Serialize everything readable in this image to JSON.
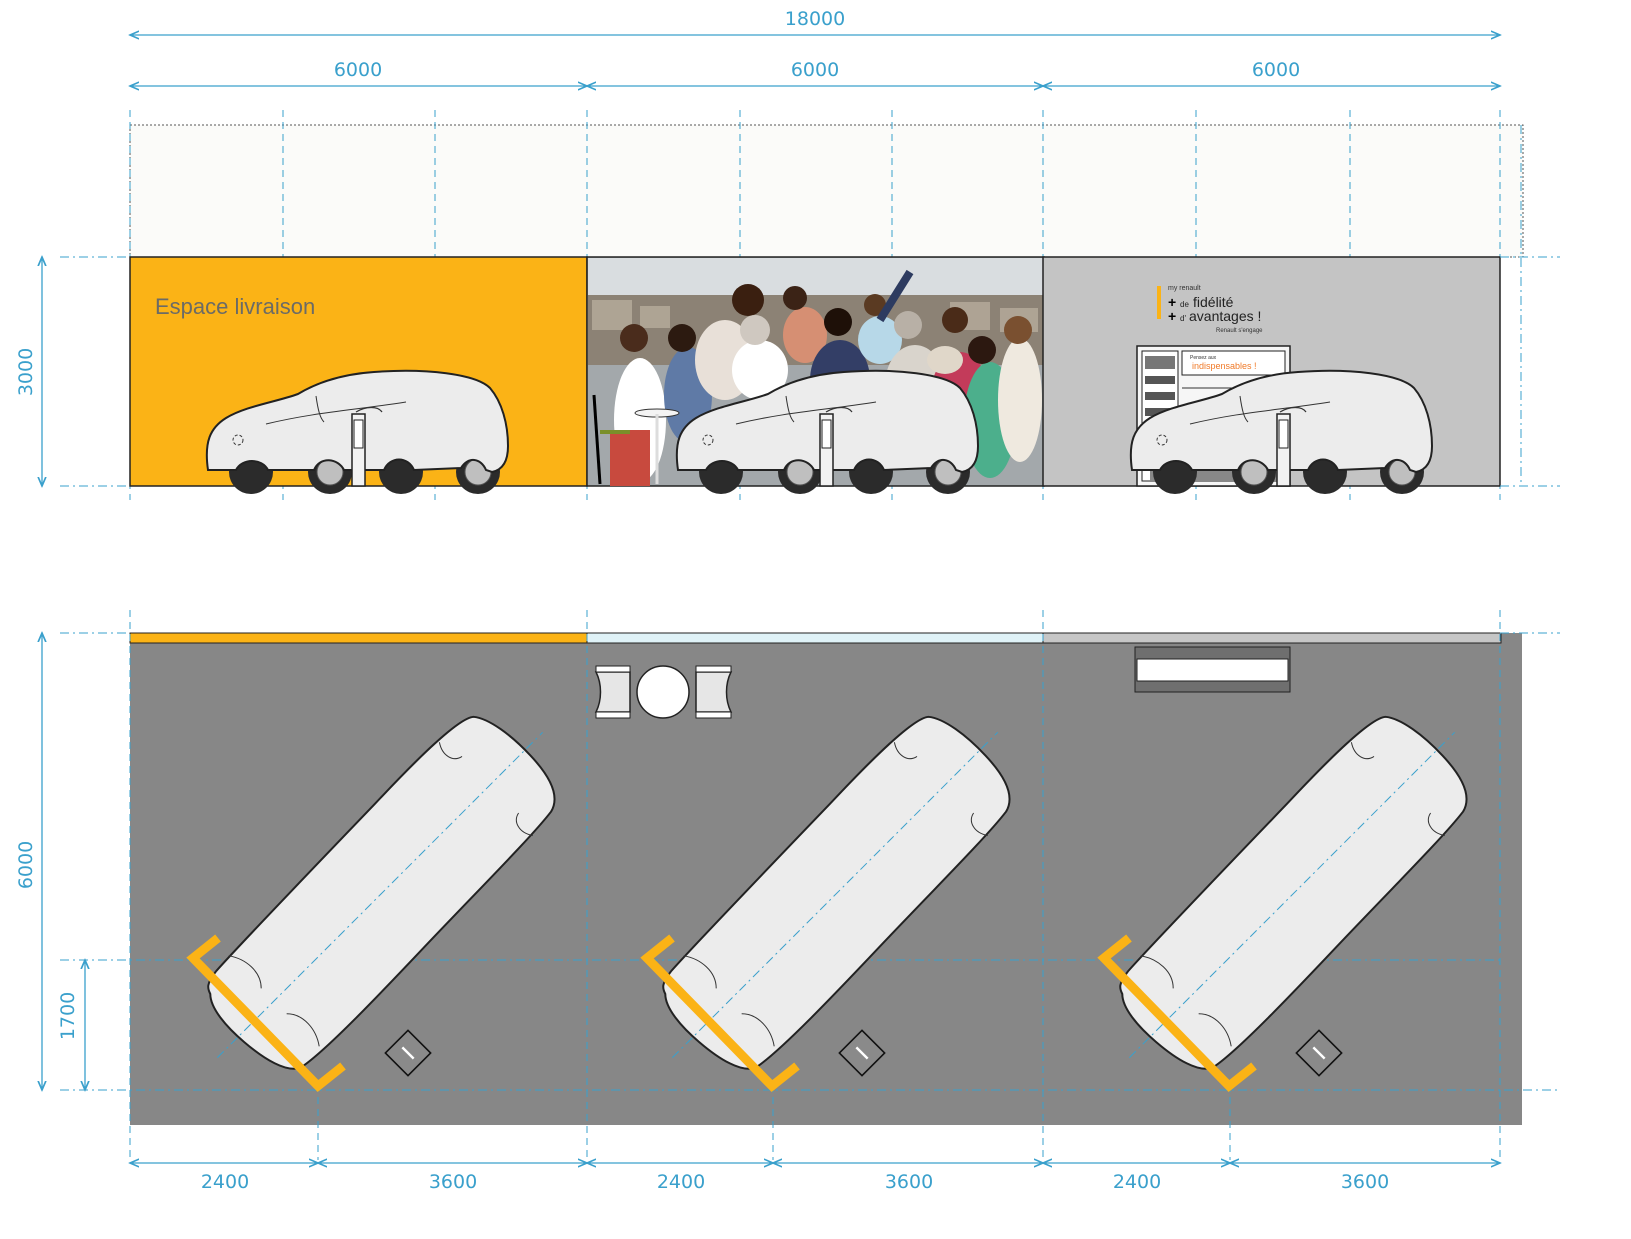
{
  "dimensions": {
    "total_width": "18000",
    "module_widths": [
      "6000",
      "6000",
      "6000"
    ],
    "elevation_height": "3000",
    "plan_depth": "6000",
    "car_offset_depth": "1700",
    "bottom_splits": [
      "2400",
      "3600",
      "2400",
      "3600",
      "2400",
      "3600"
    ]
  },
  "elevation": {
    "panel_1": {
      "title": "Espace livraison",
      "color": "#fbb316"
    },
    "panel_2": {
      "photo": "group-photo-paris-rooftop"
    },
    "panel_3": {
      "color": "#c4c4c4",
      "poster": {
        "brand": "my renault",
        "line1_prefix": "de",
        "line1_word": "fidélité",
        "line2_prefix": "d'",
        "line2_word": "avantages !",
        "signature": "Renault s'engage"
      },
      "shelf_sign": {
        "small": "Pensez aux",
        "big": "indispensables !"
      }
    }
  },
  "plan": {
    "floor_color": "#878787",
    "strip_colors": [
      "#fbb316",
      "#dff2f7",
      "#c6c6c6"
    ],
    "marker_color": "#fbb316"
  }
}
